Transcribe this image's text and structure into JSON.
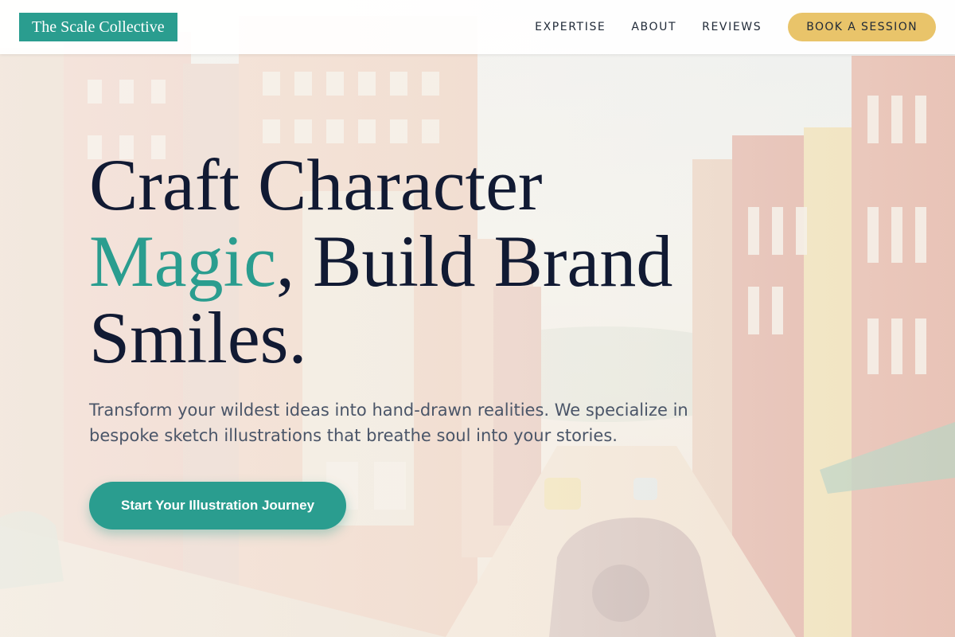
{
  "header": {
    "logo_text": "The Scale Collective",
    "nav": [
      {
        "label": "EXPERTISE"
      },
      {
        "label": "ABOUT"
      },
      {
        "label": "REVIEWS"
      }
    ],
    "book_label": "BOOK A SESSION"
  },
  "hero": {
    "headline_line1": "Craft Character",
    "headline_accent": "Magic",
    "headline_line2_rest": ", Build Brand",
    "headline_line3": "Smiles.",
    "subtitle": "Transform your wildest ideas into hand-drawn realities. We specialize in bespoke sketch illustrations that breathe soul into your stories.",
    "cta_label": "Start Your Illustration Journey"
  },
  "colors": {
    "brand_teal": "#2a9d8f",
    "accent_gold": "#e9c46a",
    "heading_navy": "#111a33",
    "body_gray": "#4a5568"
  }
}
